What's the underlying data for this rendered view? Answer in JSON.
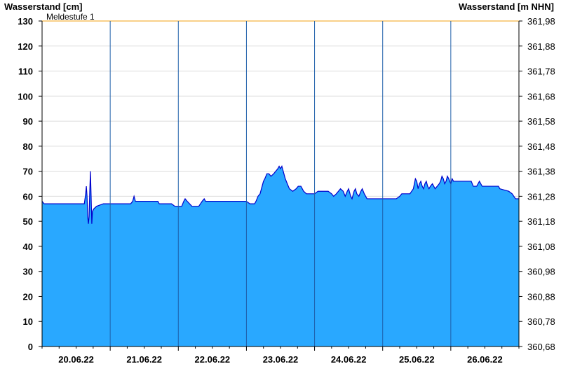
{
  "chart_data": {
    "type": "area",
    "ylabel_left": "Wasserstand [cm]",
    "ylabel_right": "Wasserstand [m NHN]",
    "ylim": [
      0,
      130
    ],
    "yticks_left": [
      0,
      10,
      20,
      30,
      40,
      50,
      60,
      70,
      80,
      90,
      100,
      110,
      120,
      130
    ],
    "ylim_right": [
      360.68,
      361.98
    ],
    "yticks_right": [
      "360,68",
      "360,78",
      "360,88",
      "360,98",
      "361,08",
      "361,18",
      "361,28",
      "361,38",
      "361,48",
      "361,58",
      "361,68",
      "361,78",
      "361,88",
      "361,98"
    ],
    "xlim": [
      0,
      7
    ],
    "x_unit": "days since 19.06.22 12:00",
    "day_labels": [
      {
        "x": 0.5,
        "label": "20.06.22"
      },
      {
        "x": 1.5,
        "label": "21.06.22"
      },
      {
        "x": 2.5,
        "label": "22.06.22"
      },
      {
        "x": 3.5,
        "label": "23.06.22"
      },
      {
        "x": 4.5,
        "label": "24.06.22"
      },
      {
        "x": 5.5,
        "label": "25.06.22"
      },
      {
        "x": 6.5,
        "label": "26.06.22"
      }
    ],
    "day_boundaries": [
      1,
      2,
      3,
      4,
      5,
      6
    ],
    "grid": true,
    "reference_lines": [
      {
        "label": "Meldestufe 1",
        "value": 130,
        "color": "#f5c060"
      }
    ],
    "fill_color": "#29a8ff",
    "line_color": "#0000cc",
    "series": [
      {
        "name": "Wasserstand",
        "points": [
          [
            0.0,
            58
          ],
          [
            0.03,
            57
          ],
          [
            0.3,
            57
          ],
          [
            0.5,
            57
          ],
          [
            0.62,
            57
          ],
          [
            0.64,
            61
          ],
          [
            0.65,
            64
          ],
          [
            0.66,
            60
          ],
          [
            0.67,
            52
          ],
          [
            0.68,
            49
          ],
          [
            0.69,
            52
          ],
          [
            0.7,
            62
          ],
          [
            0.71,
            70
          ],
          [
            0.72,
            60
          ],
          [
            0.73,
            49
          ],
          [
            0.74,
            54
          ],
          [
            0.76,
            55
          ],
          [
            0.8,
            56
          ],
          [
            0.9,
            57
          ],
          [
            1.0,
            57
          ],
          [
            1.1,
            57
          ],
          [
            1.2,
            57
          ],
          [
            1.3,
            57
          ],
          [
            1.33,
            58
          ],
          [
            1.35,
            60
          ],
          [
            1.37,
            58
          ],
          [
            1.5,
            58
          ],
          [
            1.7,
            58
          ],
          [
            1.72,
            57
          ],
          [
            1.9,
            57
          ],
          [
            1.95,
            56
          ],
          [
            2.05,
            56
          ],
          [
            2.08,
            58
          ],
          [
            2.1,
            59
          ],
          [
            2.13,
            58
          ],
          [
            2.2,
            56
          ],
          [
            2.3,
            56
          ],
          [
            2.35,
            58
          ],
          [
            2.38,
            59
          ],
          [
            2.4,
            58
          ],
          [
            2.6,
            58
          ],
          [
            2.8,
            58
          ],
          [
            3.0,
            58
          ],
          [
            3.05,
            57
          ],
          [
            3.12,
            57
          ],
          [
            3.14,
            58
          ],
          [
            3.17,
            60
          ],
          [
            3.2,
            61
          ],
          [
            3.23,
            64
          ],
          [
            3.25,
            66
          ],
          [
            3.27,
            67
          ],
          [
            3.3,
            69
          ],
          [
            3.33,
            69
          ],
          [
            3.36,
            68
          ],
          [
            3.4,
            69
          ],
          [
            3.43,
            70
          ],
          [
            3.46,
            71
          ],
          [
            3.48,
            72
          ],
          [
            3.5,
            71
          ],
          [
            3.52,
            72
          ],
          [
            3.54,
            70
          ],
          [
            3.57,
            67
          ],
          [
            3.6,
            65
          ],
          [
            3.63,
            63
          ],
          [
            3.68,
            62
          ],
          [
            3.73,
            63
          ],
          [
            3.76,
            64
          ],
          [
            3.8,
            64
          ],
          [
            3.84,
            62
          ],
          [
            3.88,
            61
          ],
          [
            3.92,
            61
          ],
          [
            3.96,
            61
          ],
          [
            4.0,
            61
          ],
          [
            4.05,
            62
          ],
          [
            4.2,
            62
          ],
          [
            4.25,
            61
          ],
          [
            4.28,
            60
          ],
          [
            4.32,
            61
          ],
          [
            4.35,
            62
          ],
          [
            4.38,
            63
          ],
          [
            4.42,
            62
          ],
          [
            4.45,
            60
          ],
          [
            4.48,
            62
          ],
          [
            4.5,
            63
          ],
          [
            4.53,
            60
          ],
          [
            4.55,
            59
          ],
          [
            4.58,
            62
          ],
          [
            4.6,
            63
          ],
          [
            4.62,
            61
          ],
          [
            4.65,
            60
          ],
          [
            4.68,
            62
          ],
          [
            4.7,
            63
          ],
          [
            4.73,
            61
          ],
          [
            4.77,
            59
          ],
          [
            4.85,
            59
          ],
          [
            5.0,
            59
          ],
          [
            5.1,
            59
          ],
          [
            5.2,
            59
          ],
          [
            5.25,
            60
          ],
          [
            5.28,
            61
          ],
          [
            5.4,
            61
          ],
          [
            5.45,
            63
          ],
          [
            5.48,
            67
          ],
          [
            5.5,
            66
          ],
          [
            5.52,
            63
          ],
          [
            5.54,
            65
          ],
          [
            5.56,
            66
          ],
          [
            5.58,
            64
          ],
          [
            5.6,
            63
          ],
          [
            5.62,
            65
          ],
          [
            5.64,
            66
          ],
          [
            5.66,
            64
          ],
          [
            5.68,
            63
          ],
          [
            5.7,
            64
          ],
          [
            5.73,
            65
          ],
          [
            5.75,
            64
          ],
          [
            5.77,
            63
          ],
          [
            5.8,
            64
          ],
          [
            5.83,
            65
          ],
          [
            5.85,
            66
          ],
          [
            5.87,
            68
          ],
          [
            5.89,
            67
          ],
          [
            5.91,
            65
          ],
          [
            5.93,
            66
          ],
          [
            5.95,
            68
          ],
          [
            5.97,
            67
          ],
          [
            6.0,
            65
          ],
          [
            6.02,
            67
          ],
          [
            6.04,
            66
          ],
          [
            6.08,
            66
          ],
          [
            6.3,
            66
          ],
          [
            6.33,
            64
          ],
          [
            6.38,
            64
          ],
          [
            6.4,
            65
          ],
          [
            6.42,
            66
          ],
          [
            6.44,
            65
          ],
          [
            6.46,
            64
          ],
          [
            6.7,
            64
          ],
          [
            6.72,
            63
          ],
          [
            6.85,
            62
          ],
          [
            6.9,
            61
          ],
          [
            6.95,
            59
          ],
          [
            7.0,
            59
          ]
        ]
      }
    ]
  }
}
